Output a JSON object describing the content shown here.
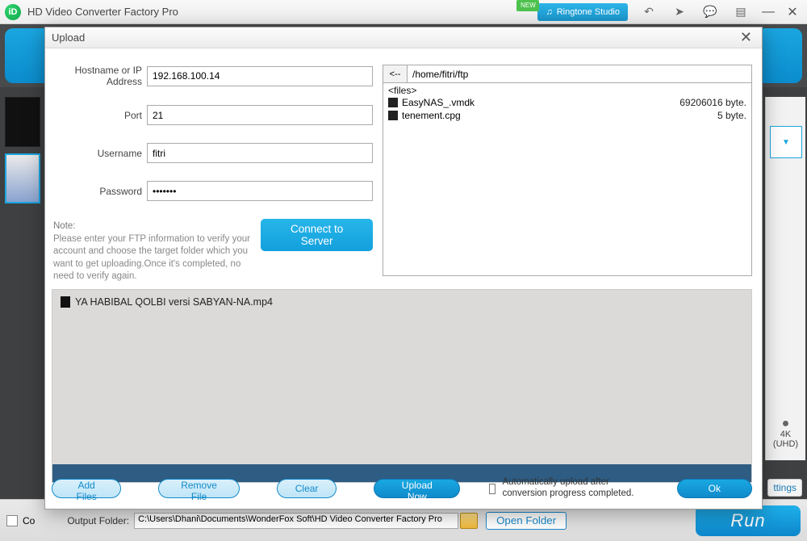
{
  "app": {
    "title": "HD Video Converter Factory Pro",
    "new_badge": "NEW",
    "ringtone": "Ringtone Studio"
  },
  "background": {
    "combine_checkbox_label_visible": "Co",
    "output_folder_label": "Output Folder:",
    "output_folder_path": "C:\\Users\\Dhani\\Documents\\WonderFox Soft\\HD Video Converter Factory Pro",
    "open_folder": "Open Folder",
    "run": "Run",
    "right_panel": {
      "dot": "●",
      "label_4k": "4K\n(UHD)"
    },
    "settings_link": "ttings"
  },
  "dialog": {
    "title": "Upload",
    "form": {
      "host_label": "Hostname or IP Address",
      "host_value": "192.168.100.14",
      "port_label": "Port",
      "port_value": "21",
      "user_label": "Username",
      "user_value": "fitri",
      "pass_label": "Password",
      "pass_value": "•••••••",
      "note_head": "Note:",
      "note_body": "Please enter your FTP information to verify your account and choose the target folder which you want to get uploading.Once it's completed, no need to verify again.",
      "connect": "Connect to Server"
    },
    "browser": {
      "back": "<--",
      "path": "/home/fitri/ftp",
      "files_header": "<files>",
      "files": [
        {
          "name": "EasyNAS_.vmdk",
          "size": "69206016 byte."
        },
        {
          "name": "tenement.cpg",
          "size": "5 byte."
        }
      ]
    },
    "queue": {
      "items": [
        "YA HABIBAL QOLBI versi SABYAN-NA.mp4"
      ]
    },
    "actions": {
      "add": "Add Files",
      "remove": "Remove File",
      "clear": "Clear",
      "upload_now": "Upload Now",
      "auto_upload": "Automatically upload after conversion progress completed.",
      "ok": "Ok"
    }
  }
}
